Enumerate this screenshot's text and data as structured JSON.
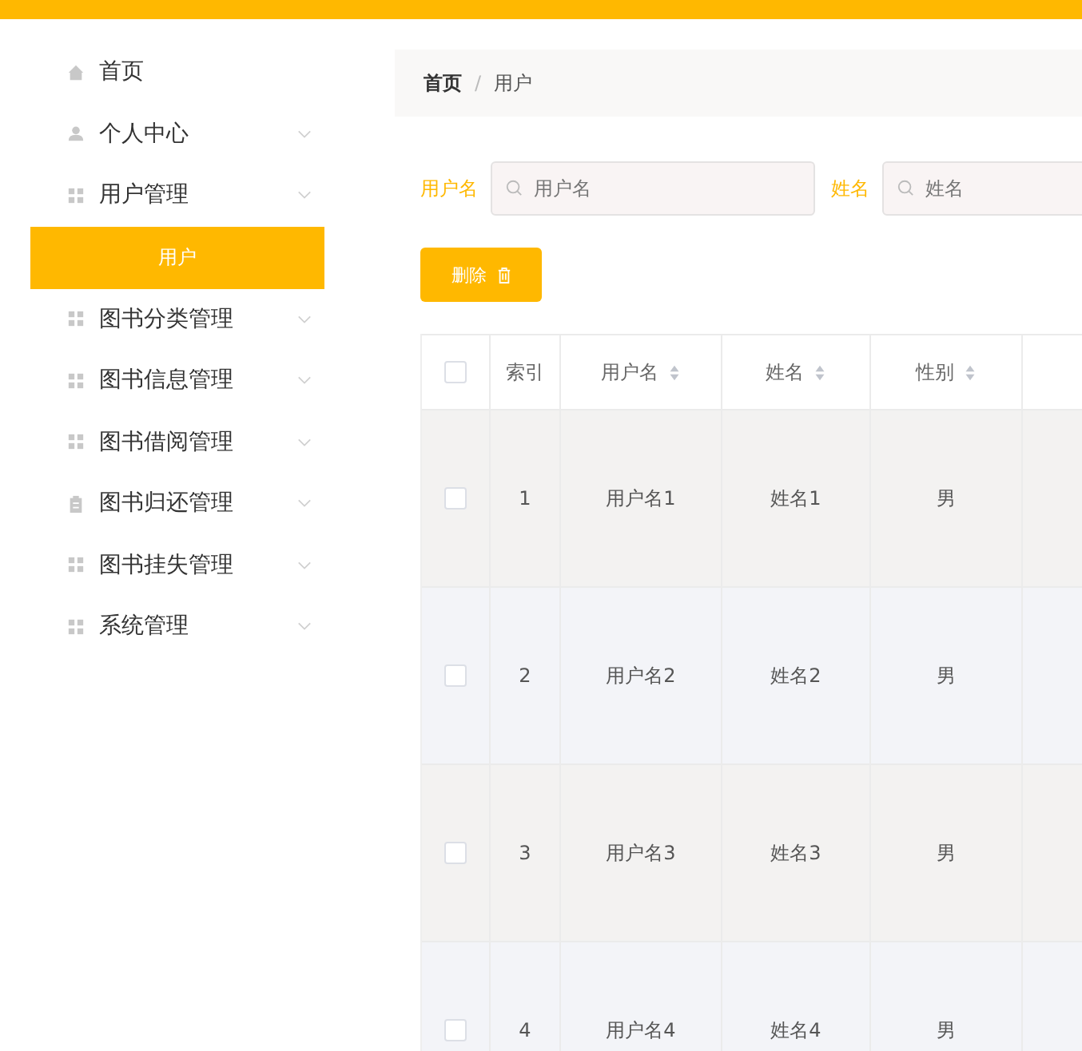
{
  "sidebar": {
    "items": [
      {
        "label": "首页",
        "kind": "home",
        "has_arrow": false,
        "selected": false
      },
      {
        "label": "个人中心",
        "kind": "user",
        "has_arrow": true,
        "selected": false
      },
      {
        "label": "用户管理",
        "kind": "grid",
        "has_arrow": true,
        "selected": false,
        "children": [
          {
            "label": "用户",
            "selected": true
          }
        ]
      },
      {
        "label": "图书分类管理",
        "kind": "grid",
        "has_arrow": true,
        "selected": false
      },
      {
        "label": "图书信息管理",
        "kind": "grid",
        "has_arrow": true,
        "selected": false
      },
      {
        "label": "图书借阅管理",
        "kind": "grid",
        "has_arrow": true,
        "selected": false
      },
      {
        "label": "图书归还管理",
        "kind": "doc",
        "has_arrow": true,
        "selected": false
      },
      {
        "label": "图书挂失管理",
        "kind": "grid",
        "has_arrow": true,
        "selected": false
      },
      {
        "label": "系统管理",
        "kind": "grid",
        "has_arrow": true,
        "selected": false
      }
    ]
  },
  "breadcrumb": {
    "items": [
      "首页",
      "用户"
    ],
    "separator": "/"
  },
  "search": [
    {
      "label": "用户名",
      "placeholder": "用户名"
    },
    {
      "label": "姓名",
      "placeholder": "姓名"
    }
  ],
  "delete_button": "删除",
  "table": {
    "all_checked": false,
    "columns": [
      {
        "label": "索引",
        "sortable": false
      },
      {
        "label": "用户名",
        "sortable": true
      },
      {
        "label": "姓名",
        "sortable": true
      },
      {
        "label": "性别",
        "sortable": true
      }
    ],
    "rows": [
      {
        "checked": false,
        "cells": [
          "1",
          "用户名1",
          "姓名1",
          "男"
        ]
      },
      {
        "checked": false,
        "cells": [
          "2",
          "用户名2",
          "姓名2",
          "男"
        ]
      },
      {
        "checked": false,
        "cells": [
          "3",
          "用户名3",
          "姓名3",
          "男"
        ]
      },
      {
        "checked": false,
        "cells": [
          "4",
          "用户名4",
          "姓名4",
          "男"
        ]
      }
    ]
  }
}
